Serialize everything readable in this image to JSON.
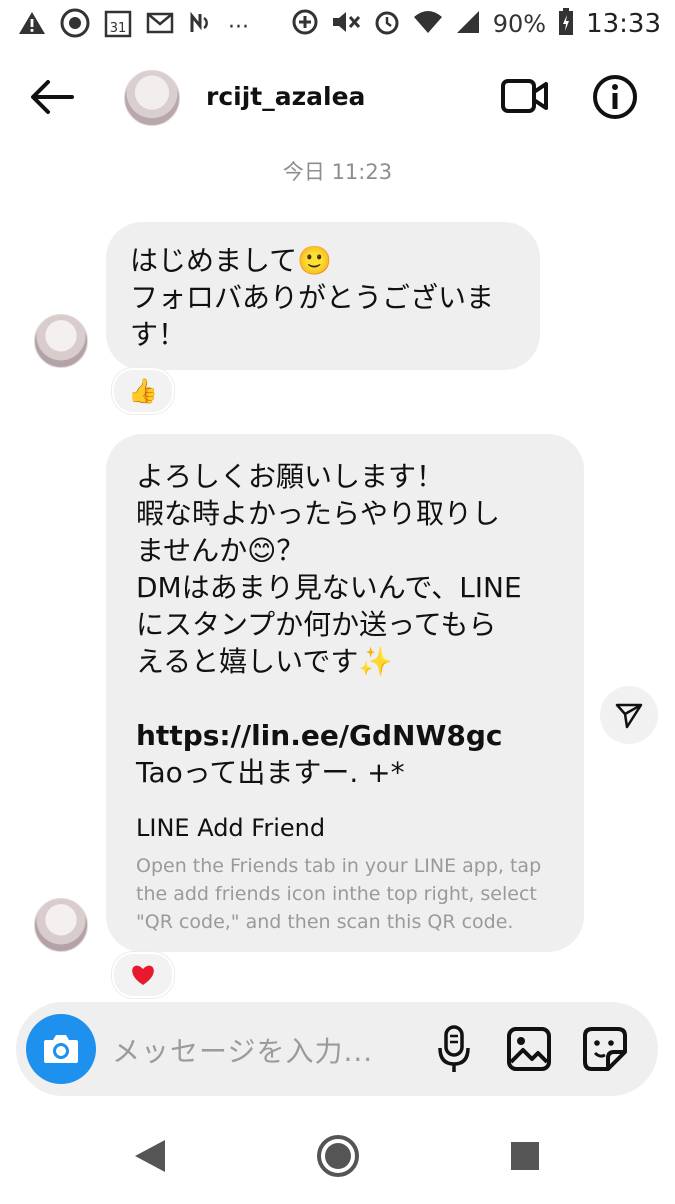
{
  "status_bar": {
    "battery_percent": "90%",
    "time": "13:33",
    "calendar_day": "31"
  },
  "header": {
    "username": "rcijt_azalea"
  },
  "timestamp": "今日 11:23",
  "messages": [
    {
      "lines": [
        "はじめまして🙂",
        "フォロバありがとうございま",
        "す！"
      ],
      "reaction": "👍"
    },
    {
      "lines": [
        "よろしくお願いします！",
        "暇な時よかったらやり取りし",
        "ませんか😊？",
        "DMはあまり見ないんで、LINE",
        "にスタンプか何か送ってもら",
        "えると嬉しいです✨"
      ],
      "link": "https://lin.ee/GdNW8gc",
      "after_link": "Taoって出ますー. +*",
      "card_title": "LINE Add Friend",
      "card_desc": "Open the Friends tab in your LINE app, tap the add friends icon inthe top right, select \"QR code,\" and then scan this QR code.",
      "reaction": "❤️"
    }
  ],
  "composer": {
    "placeholder": "メッセージを入力..."
  },
  "colors": {
    "camera_button": "#1e90ee",
    "bubble_bg": "#efefef",
    "heart": "#e8192c"
  }
}
